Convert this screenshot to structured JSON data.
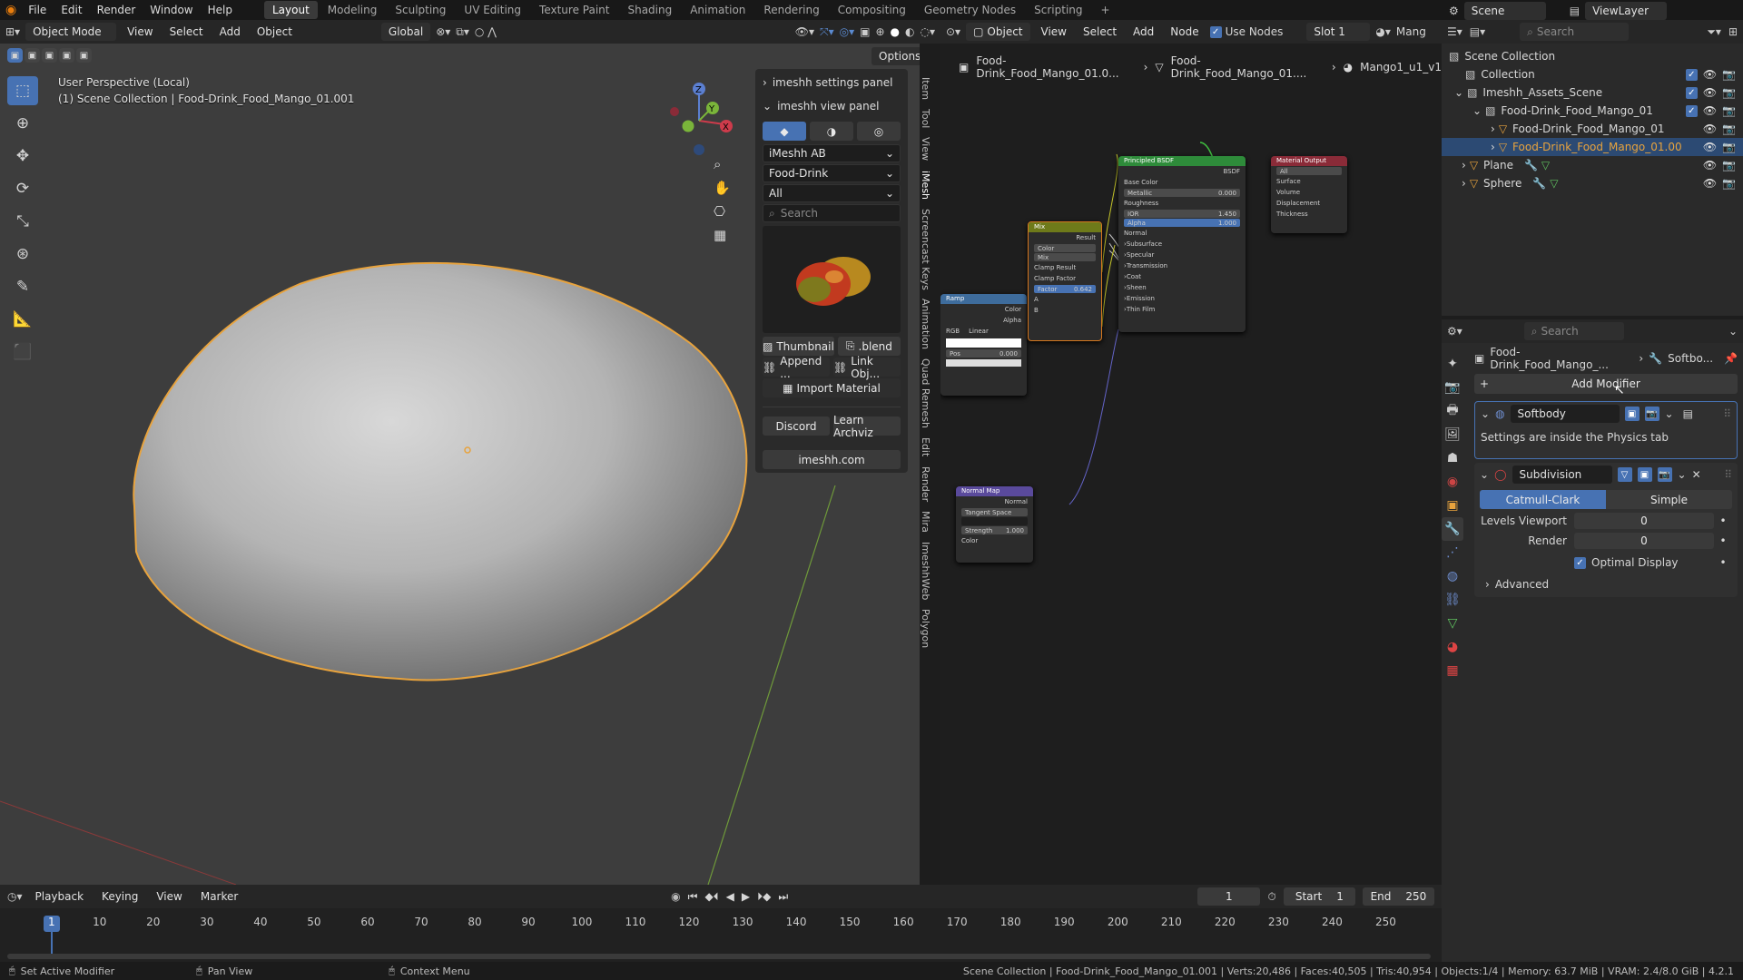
{
  "menubar": {
    "menus": [
      "File",
      "Edit",
      "Render",
      "Window",
      "Help"
    ],
    "workspaces": [
      "Layout",
      "Modeling",
      "Sculpting",
      "UV Editing",
      "Texture Paint",
      "Shading",
      "Animation",
      "Rendering",
      "Compositing",
      "Geometry Nodes",
      "Scripting"
    ],
    "active_workspace": "Layout",
    "add_tab": "+",
    "scene": "Scene",
    "view_layer": "ViewLayer"
  },
  "viewport": {
    "mode": "Object Mode",
    "menus": [
      "View",
      "Select",
      "Add",
      "Object"
    ],
    "transform": "Global",
    "options": "Options",
    "info_line1": "User Perspective (Local)",
    "info_line2": "(1) Scene Collection | Food-Drink_Food_Mango_01.001",
    "gizmo": {
      "x": "X",
      "y": "Y",
      "z": "Z"
    }
  },
  "npanel": {
    "settings_header": "imeshh settings panel",
    "view_header": "imeshh view panel",
    "library": "iMeshh AB",
    "category": "Food-Drink",
    "filter": "All",
    "search_placeholder": "Search",
    "thumbnail_label": "Thumbnail",
    "blend_label": ".blend",
    "append_label": "Append ...",
    "link_label": "Link Obj...",
    "import_material": "Import Material",
    "discord": "Discord",
    "learn_archviz": "Learn Archviz",
    "website": "imeshh.com"
  },
  "vertical_tabs": [
    "Item",
    "Tool",
    "View",
    "iMesh",
    "Screencast Keys",
    "Animation",
    "Quad Remesh",
    "Edit",
    "Render",
    "Mira",
    "ImeshhWeb",
    "Polygon"
  ],
  "node_editor": {
    "object_mode": "Object",
    "menus": [
      "View",
      "Select",
      "Add",
      "Node"
    ],
    "use_nodes": "Use Nodes",
    "slot": "Slot 1",
    "material_short": "Mang",
    "breadcrumb": [
      "Food-Drink_Food_Mango_01.0...",
      "Food-Drink_Food_Mango_01....",
      "Mango1_u1_v1"
    ],
    "principled": {
      "title": "Principled BSDF",
      "output": "BSDF",
      "base_color": "Base Color",
      "metallic": "Metallic",
      "metallic_val": "0.000",
      "roughness": "Roughness",
      "ior": "IOR",
      "ior_val": "1.450",
      "alpha": "Alpha",
      "alpha_val": "1.000",
      "normal": "Normal",
      "subs": [
        "Subsurface",
        "Specular",
        "Transmission",
        "Coat",
        "Sheen",
        "Emission",
        "Thin Film"
      ]
    },
    "material_output": {
      "title": "Material Output",
      "target": "All",
      "sockets": [
        "Surface",
        "Volume",
        "Displacement",
        "Thickness"
      ]
    },
    "mix": {
      "title": "Mix",
      "result": "Result",
      "type": "Color",
      "blend": "Mix",
      "clamp_result": "Clamp Result",
      "clamp_factor": "Clamp Factor",
      "factor": "Factor",
      "factor_val": "0.642",
      "a": "A",
      "b": "B"
    },
    "ramp": {
      "title": "Ramp",
      "color": "Color",
      "alpha": "Alpha",
      "mode": "RGB",
      "interp": "Linear",
      "pos": "Pos",
      "pos_val": "0.000"
    },
    "normal_map": {
      "title": "Normal Map",
      "normal": "Normal",
      "space": "Tangent Space",
      "strength": "Strength",
      "strength_val": "1.000",
      "color": "Color"
    }
  },
  "outliner": {
    "search_placeholder": "Search",
    "items": [
      {
        "label": "Scene Collection",
        "depth": 0
      },
      {
        "label": "Collection",
        "depth": 1
      },
      {
        "label": "Imeshh_Assets_Scene",
        "depth": 1
      },
      {
        "label": "Food-Drink_Food_Mango_01",
        "depth": 2
      },
      {
        "label": "Food-Drink_Food_Mango_01",
        "depth": 3
      },
      {
        "label": "Food-Drink_Food_Mango_01.00",
        "depth": 3
      },
      {
        "label": "Plane",
        "depth": 1
      },
      {
        "label": "Sphere",
        "depth": 1
      }
    ]
  },
  "properties": {
    "search_placeholder": "Search",
    "object_name": "Food-Drink_Food_Mango_...",
    "modifier_crumb": "Softbo...",
    "add_modifier": "Add Modifier",
    "softbody": {
      "name": "Softbody",
      "note": "Settings are inside the Physics tab"
    },
    "subdivision": {
      "name": "Subdivision",
      "catmull": "Catmull-Clark",
      "simple": "Simple",
      "levels_label": "Levels Viewport",
      "levels_val": "0",
      "render_label": "Render",
      "render_val": "0",
      "optimal": "Optimal Display",
      "advanced": "Advanced"
    }
  },
  "timeline": {
    "menus": [
      "Playback",
      "Keying",
      "View",
      "Marker"
    ],
    "current_frame": "1",
    "start_label": "Start",
    "start_val": "1",
    "end_label": "End",
    "end_val": "250",
    "ticks": [
      "1",
      "10",
      "20",
      "30",
      "40",
      "50",
      "60",
      "70",
      "80",
      "90",
      "100",
      "110",
      "120",
      "130",
      "140",
      "150",
      "160",
      "170",
      "180",
      "190",
      "200",
      "210",
      "220",
      "230",
      "240",
      "250"
    ]
  },
  "statusbar": {
    "left": "Set Active Modifier",
    "middle": "Pan View",
    "context": "Context Menu",
    "stats": "Scene Collection | Food-Drink_Food_Mango_01.001 | Verts:20,486 | Faces:40,505 | Tris:40,954 | Objects:1/4 | Memory: 63.7 MiB | VRAM: 2.4/8.0 GiB | 4.2.1"
  },
  "colors": {
    "accent": "#4772b3",
    "selection_outline": "#e8a33d",
    "panel": "#2a2a2a",
    "viewport": "#3d3d3d"
  }
}
